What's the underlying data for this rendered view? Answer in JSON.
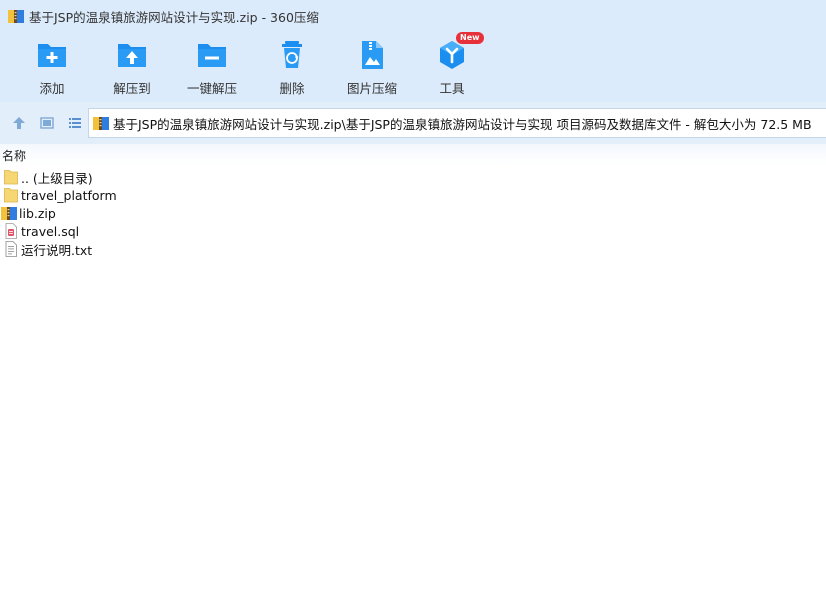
{
  "window": {
    "title": "基于JSP的温泉镇旅游网站设计与实现.zip - 360压缩"
  },
  "toolbar": {
    "items": [
      {
        "label": "添加",
        "icon": "add-folder-icon"
      },
      {
        "label": "解压到",
        "icon": "extract-to-icon"
      },
      {
        "label": "一键解压",
        "icon": "one-click-extract-icon"
      },
      {
        "label": "删除",
        "icon": "recycle-bin-icon"
      },
      {
        "label": "图片压缩",
        "icon": "image-compress-icon"
      },
      {
        "label": "工具",
        "icon": "tools-icon",
        "badge": "New"
      }
    ]
  },
  "navbar": {
    "path": "基于JSP的温泉镇旅游网站设计与实现.zip\\基于JSP的温泉镇旅游网站设计与实现 项目源码及数据库文件 - 解包大小为 72.5 MB"
  },
  "fileview": {
    "column_name": "名称",
    "files": [
      {
        "name": ".. (上级目录)",
        "type": "folder"
      },
      {
        "name": "travel_platform",
        "type": "folder"
      },
      {
        "name": "lib.zip",
        "type": "zip"
      },
      {
        "name": "travel.sql",
        "type": "sql"
      },
      {
        "name": "运行说明.txt",
        "type": "txt"
      }
    ]
  },
  "colors": {
    "toolbar_bg": "#dcebfb",
    "icon_blue": "#1b8ef0",
    "folder_yellow": "#f7d774",
    "badge_red": "#e8303a"
  }
}
